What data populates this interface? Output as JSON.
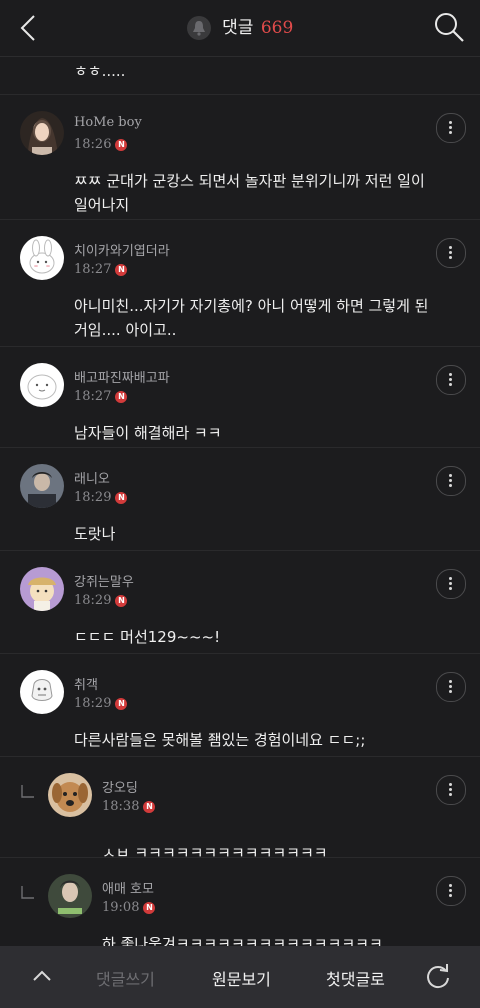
{
  "header": {
    "title": "댓글",
    "count": "669",
    "back_icon": "chevron-left-icon",
    "search_icon": "search-icon",
    "bell_icon": "bell-icon"
  },
  "partial_comment": {
    "text": "ㅎㅎ....."
  },
  "comments": [
    {
      "author": "HoMe boy",
      "time": "18:26",
      "badge": "N",
      "body": "ㅉㅉ 군대가 군캉스 되면서 놀자판 분위기니까 저런 일이 일어나지",
      "avatar_color": "#6b5a4e"
    },
    {
      "author": "치이카와기엽더라",
      "time": "18:27",
      "badge": "N",
      "body": "아니미친...자기가 자기총에? 아니 어떻게 하면 그렇게 된거임.... 아이고..",
      "avatar_color": "#ffffff"
    },
    {
      "author": "배고파진짜배고파",
      "time": "18:27",
      "badge": "N",
      "body": "남자들이 해결해라 ㅋㅋ",
      "avatar_color": "#ffffff"
    },
    {
      "author": "래니오",
      "time": "18:29",
      "badge": "N",
      "body": "도랏나",
      "avatar_color": "#4b5058"
    },
    {
      "author": "강쥐는말우",
      "time": "18:29",
      "badge": "N",
      "body": "ㄷㄷㄷ 머선129~~~!",
      "avatar_color": "#b79bd3"
    },
    {
      "author": "취객",
      "time": "18:29",
      "badge": "N",
      "body": "다른사람들은 못해볼 좸있는 경험이네요 ㄷㄷ;;",
      "avatar_color": "#ffffff"
    }
  ],
  "replies": [
    {
      "author": "강오딩",
      "time": "18:38",
      "badge": "N",
      "body": "ㅅㅂ ㅋㅋㅋㅋㅋㅋㅋㅋㅋㅋㅋㅋㅋㅋ",
      "avatar_color": "#c59a6a"
    },
    {
      "author": "애매 호모",
      "time": "19:08",
      "badge": "N",
      "body": "하 좋나웃겨ㅋㅋㅋㅋㅋㅋㅋㅋㅋㅋㅋㅋㅋㅋㅋ",
      "avatar_color": "#3f4a3c"
    }
  ],
  "bottombar": {
    "write": "댓글쓰기",
    "original": "원문보기",
    "first": "첫댓글로",
    "up_icon": "chevron-up-icon",
    "refresh_icon": "refresh-icon"
  }
}
